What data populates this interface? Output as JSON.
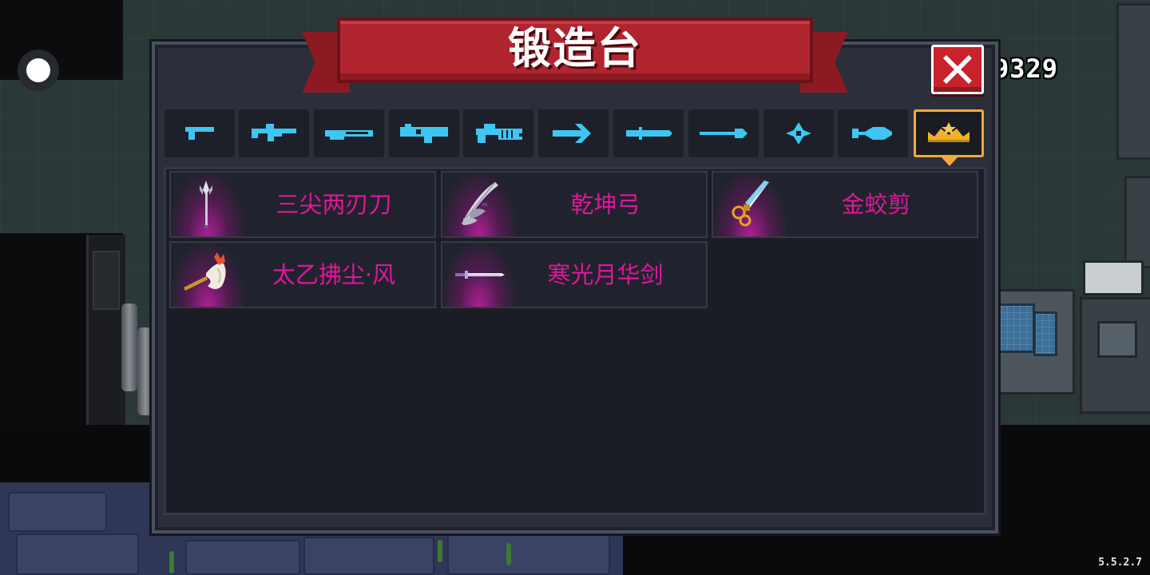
{
  "header": {
    "title": "锻造台",
    "gold": "9329",
    "version": "5.5.2.7"
  },
  "tabs": [
    {
      "icon": "pistol-icon",
      "selected": false
    },
    {
      "icon": "rifle-icon",
      "selected": false
    },
    {
      "icon": "shotgun-icon",
      "selected": false
    },
    {
      "icon": "launcher-icon",
      "selected": false
    },
    {
      "icon": "laser-gun-icon",
      "selected": false
    },
    {
      "icon": "arrow-weapon-icon",
      "selected": false
    },
    {
      "icon": "sword-icon",
      "selected": false
    },
    {
      "icon": "spear-icon",
      "selected": false
    },
    {
      "icon": "shuriken-icon",
      "selected": false
    },
    {
      "icon": "fish-weapon-icon",
      "selected": false
    },
    {
      "icon": "crown-icon",
      "selected": true
    }
  ],
  "weapons": [
    {
      "name": "三尖两刃刀",
      "icon": "trident-blade-icon"
    },
    {
      "name": "乾坤弓",
      "icon": "bow-icon"
    },
    {
      "name": "金蛟剪",
      "icon": "golden-scissors-icon"
    },
    {
      "name": "太乙拂尘·风",
      "icon": "whisk-icon"
    },
    {
      "name": "寒光月华剑",
      "icon": "moon-sword-icon"
    }
  ],
  "colors": {
    "ribbon": "#b02530",
    "tab_icon": "#3ec6f2",
    "selected_tab_border": "#f2a93b",
    "weapon_name": "#e0169a",
    "weapon_glow": "#c81ea8"
  }
}
